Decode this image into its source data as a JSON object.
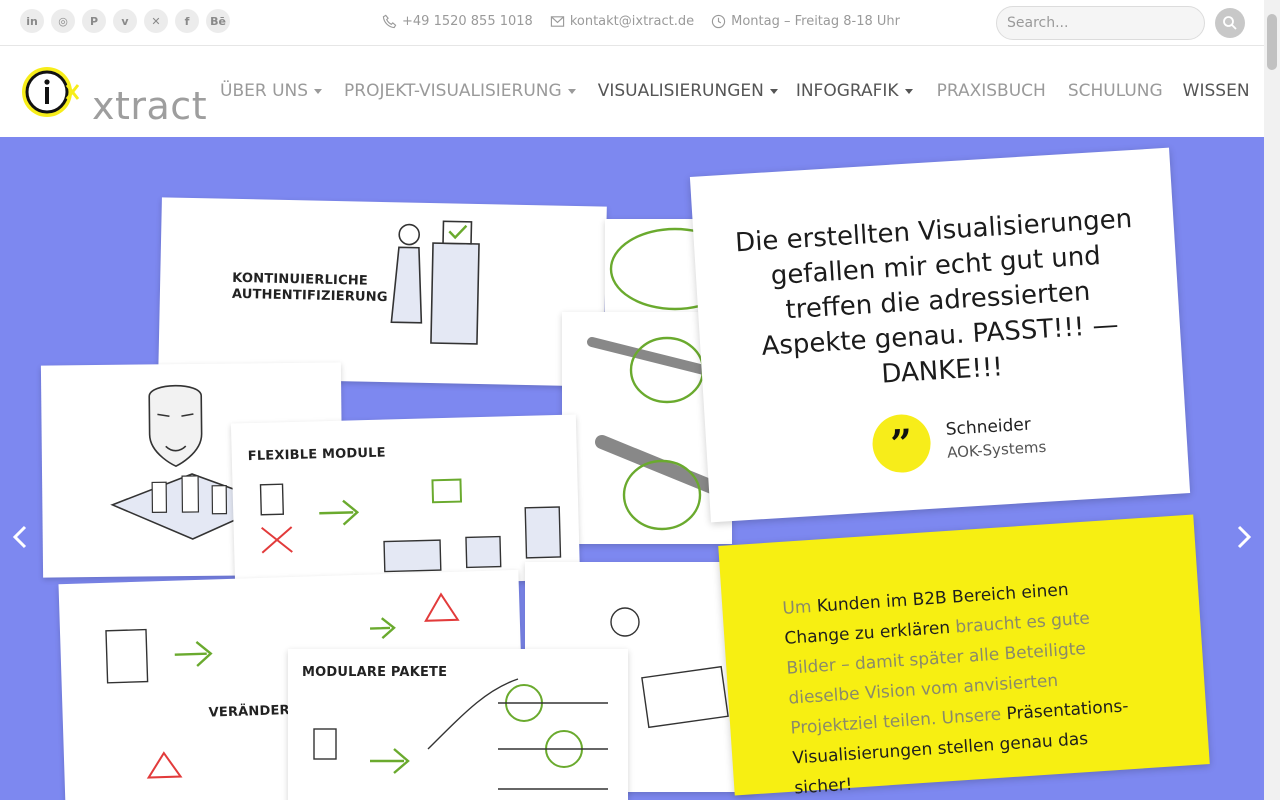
{
  "topbar": {
    "social": [
      {
        "icon": "linkedin-icon",
        "glyph": "in"
      },
      {
        "icon": "instagram-icon",
        "glyph": "◎"
      },
      {
        "icon": "pinterest-icon",
        "glyph": "P"
      },
      {
        "icon": "vimeo-icon",
        "glyph": "v"
      },
      {
        "icon": "xing-icon",
        "glyph": "✕"
      },
      {
        "icon": "facebook-icon",
        "glyph": "f"
      },
      {
        "icon": "behance-icon",
        "glyph": "Bē"
      }
    ],
    "phone": "+49 1520 855 1018",
    "email": "kontakt@ixtract.de",
    "hours": "Montag – Freitag 8-18 Uhr",
    "search_placeholder": "Search..."
  },
  "nav": {
    "logo_text": "xtract",
    "items": [
      {
        "label": "ÜBER UNS",
        "dropdown": true
      },
      {
        "label": "PROJEKT-VISUALISIERUNG",
        "dropdown": true
      },
      {
        "label": "VISUALISIERUNGEN",
        "dropdown": true
      },
      {
        "label": "INFOGRAFIK",
        "dropdown": true
      },
      {
        "label": "PRAXISBUCH",
        "dropdown": false
      },
      {
        "label": "SCHULUNG",
        "dropdown": false
      },
      {
        "label": "WISSEN",
        "dropdown": false
      }
    ]
  },
  "hero": {
    "cards": {
      "kontinuierliche": "KONTINUIERLICHE AUTHENTIFIZIERUNG",
      "flexible": "FLEXIBLE MODULE",
      "veraenderte": "VERÄNDERTE BE",
      "modulare": "MODULARE PAKETE"
    },
    "quote": {
      "text": "Die erstellten Visualisierungen gefallen mir echt gut und treffen die adressierten Aspekte genau. PASST!!! — DANKE!!!",
      "name": "Schneider",
      "company": "AOK-Systems",
      "badge": "”"
    },
    "info": {
      "p1": "Um ",
      "b1": "Kunden im B2B Bereich einen Change zu erklären",
      "p2": " braucht es gute Bilder – damit später alle Beteiligte dieselbe Vision vom anvisierten Projektziel teilen. Unsere ",
      "b2": "Präsentations-Visualisierungen stellen genau das sicher!"
    }
  },
  "colors": {
    "hero_bg": "#7d88f0",
    "accent_yellow": "#f7ef12",
    "sketch_green": "#6aaa2e",
    "warning_red": "#e23b3b"
  }
}
